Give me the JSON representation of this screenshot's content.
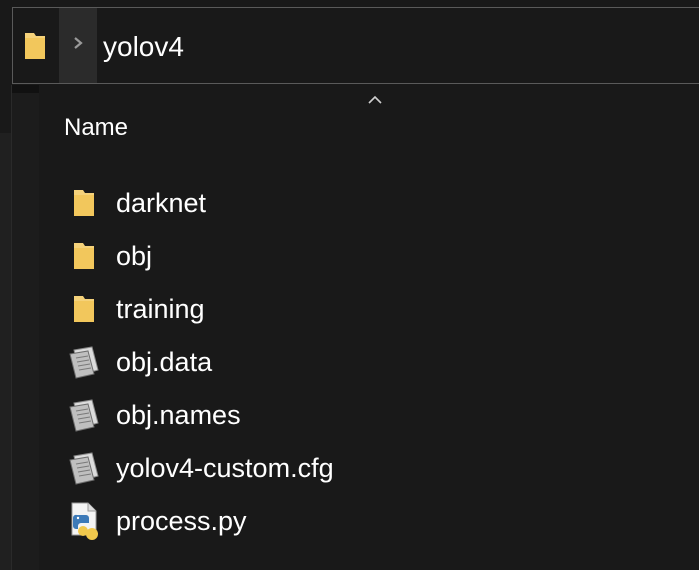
{
  "address_bar": {
    "path": "yolov4",
    "folder_icon": "folder-icon",
    "separator_icon": "chevron-right-icon"
  },
  "header": {
    "name_label": "Name",
    "sort_icon": "sort-ascending-icon"
  },
  "files": [
    {
      "name": "darknet",
      "icon": "folder-icon",
      "type": "folder"
    },
    {
      "name": "obj",
      "icon": "folder-icon",
      "type": "folder"
    },
    {
      "name": "training",
      "icon": "folder-icon",
      "type": "folder"
    },
    {
      "name": "obj.data",
      "icon": "text-file-icon",
      "type": "file"
    },
    {
      "name": "obj.names",
      "icon": "text-file-icon",
      "type": "file"
    },
    {
      "name": "yolov4-custom.cfg",
      "icon": "text-file-icon",
      "type": "file"
    },
    {
      "name": "process.py",
      "icon": "python-file-icon",
      "type": "file"
    }
  ],
  "colors": {
    "background": "#191919",
    "folder": "#f5d27a",
    "text": "#ffffff"
  }
}
